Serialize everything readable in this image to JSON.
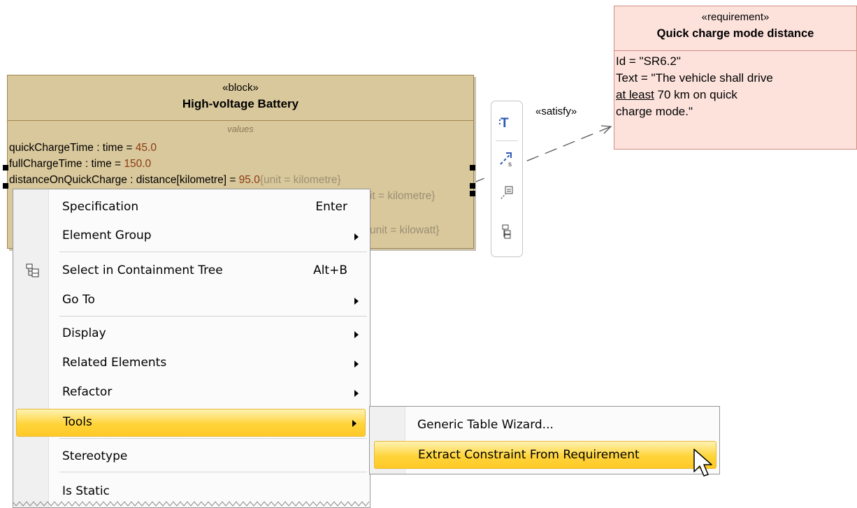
{
  "block": {
    "stereotype": "«block»",
    "name": "High-voltage Battery",
    "compartment_title": "values",
    "properties": [
      {
        "name": "quickChargeTime : time = ",
        "value": "45.0",
        "tag": ""
      },
      {
        "name": "fullChargeTime : time = ",
        "value": "150.0",
        "tag": ""
      },
      {
        "name": "distanceOnQuickCharge : distance[kilometre] = ",
        "value": "95.0",
        "tag": "{unit = kilometre}"
      }
    ],
    "hidden_tags": [
      "it = kilometre}",
      "unit = kilowatt}"
    ]
  },
  "requirement": {
    "stereotype": "«requirement»",
    "name": "Quick charge mode distance",
    "id_line": "Id = \"SR6.2\"",
    "text_line1": "Text = \"The vehicle shall drive",
    "text_underlined": "at least",
    "text_line2_rest": " 70 km on quick",
    "text_line3": "charge mode.\""
  },
  "connector": {
    "label": "«satisfy»"
  },
  "smart_manipulator": {
    "buttons": [
      "text-format-icon",
      "satisfy-relation-icon",
      "note-icon",
      "structure-icon"
    ]
  },
  "context_menu": {
    "items": [
      {
        "label": "Specification",
        "shortcut": "Enter",
        "submenu": false
      },
      {
        "label": "Element Group",
        "shortcut": "",
        "submenu": true
      },
      {
        "label": "Select in Containment Tree",
        "shortcut": "Alt+B",
        "submenu": false
      },
      {
        "label": "Go To",
        "shortcut": "",
        "submenu": true
      },
      {
        "label": "Display",
        "shortcut": "",
        "submenu": true
      },
      {
        "label": "Related Elements",
        "shortcut": "",
        "submenu": true
      },
      {
        "label": "Refactor",
        "shortcut": "",
        "submenu": true
      },
      {
        "label": "Tools",
        "shortcut": "",
        "submenu": true,
        "highlighted": true
      },
      {
        "label": "Stereotype",
        "shortcut": "",
        "submenu": false
      },
      {
        "label": "Is Static",
        "shortcut": "",
        "submenu": false
      }
    ]
  },
  "tools_submenu": {
    "items": [
      {
        "label": "Generic Table Wizard..."
      },
      {
        "label": "Extract Constraint From Requirement",
        "highlighted": true
      }
    ]
  },
  "colors": {
    "block_fill": "#d9c89b",
    "requirement_fill": "#fde2dc",
    "highlight": "#ffd43a",
    "value_text": "#8b3a14"
  }
}
